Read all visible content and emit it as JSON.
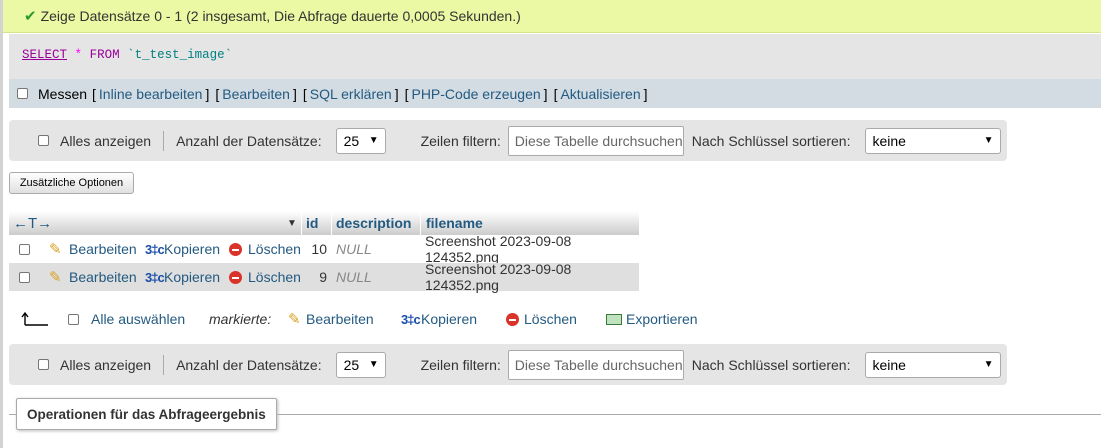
{
  "success": {
    "icon": "check-icon",
    "text": "Zeige Datensätze 0 - 1 (2 insgesamt, Die Abfrage dauerte 0,0005 Sekunden.)"
  },
  "sql": {
    "select": "SELECT",
    "star": "*",
    "from": "FROM",
    "table": "`t_test_image`"
  },
  "query_links": {
    "messen": "Messen",
    "open": "[",
    "close": "]",
    "inline_edit": "Inline bearbeiten",
    "edit": "Bearbeiten",
    "explain": "SQL erklären",
    "php_code": "PHP-Code erzeugen",
    "refresh": "Aktualisieren"
  },
  "nav": {
    "show_all": "Alles anzeigen",
    "rows_label": "Anzahl der Datensätze:",
    "rows_value": "25",
    "filter_label": "Zeilen filtern:",
    "filter_placeholder": "Diese Tabelle durchsuchen",
    "sort_label": "Nach Schlüssel sortieren:",
    "sort_value": "keine"
  },
  "extra_options_label": "Zusätzliche Optionen",
  "table": {
    "arrows": "←T→",
    "columns": [
      "id",
      "description",
      "filename"
    ],
    "actions": {
      "edit": "Bearbeiten",
      "copy": "Kopieren",
      "delete": "Löschen"
    },
    "rows": [
      {
        "id": "10",
        "description": "NULL",
        "filename": "Screenshot 2023-09-08 124352.png"
      },
      {
        "id": "9",
        "description": "NULL",
        "filename": "Screenshot 2023-09-08 124352.png"
      }
    ]
  },
  "bulk": {
    "select_all": "Alle auswählen",
    "marked": "markierte:",
    "edit": "Bearbeiten",
    "copy": "Kopieren",
    "delete": "Löschen",
    "export": "Exportieren"
  },
  "operations_label": "Operationen für das Abfrageergebnis"
}
